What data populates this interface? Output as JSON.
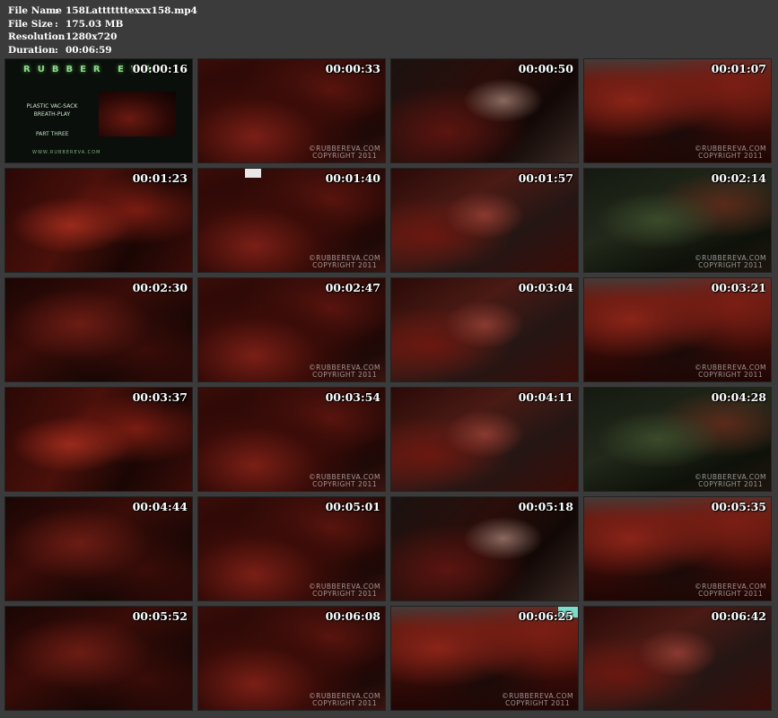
{
  "file_info": [
    {
      "key": "File Name",
      "sep": ":",
      "value": "158Latttttttexxx158.mp4"
    },
    {
      "key": "File Size",
      "sep": ":",
      "value": "175.03 MB"
    },
    {
      "key": "Resolution",
      "sep": ":",
      "value": "1280x720"
    },
    {
      "key": "Duration",
      "sep": ":",
      "value": "00:06:59"
    }
  ],
  "title_card": {
    "logo": "RUBBER EVA",
    "subtitle_line1": "PLASTIC VAC-SACK",
    "subtitle_line2": "BREATH-PLAY",
    "part": "PART THREE",
    "site": "WWW.RUBBEREVA.COM"
  },
  "watermark": {
    "line1": "©RUBBEREVA.COM",
    "line2": "COPYRIGHT 2011"
  },
  "thumbnails": [
    {
      "time": "00:00:16",
      "scene": "title"
    },
    {
      "time": "00:00:33",
      "scene": "couch-dark",
      "watermark": true
    },
    {
      "time": "00:00:50",
      "scene": "sheen"
    },
    {
      "time": "00:01:07",
      "scene": "couch-red",
      "watermark": true
    },
    {
      "time": "00:01:23",
      "scene": "red-close"
    },
    {
      "time": "00:01:40",
      "scene": "couch-dark",
      "watermark": true
    },
    {
      "time": "00:01:57",
      "scene": "red-sheen"
    },
    {
      "time": "00:02:14",
      "scene": "green-sheen",
      "watermark": true
    },
    {
      "time": "00:02:30",
      "scene": "blur-red"
    },
    {
      "time": "00:02:47",
      "scene": "couch-dark",
      "watermark": true
    },
    {
      "time": "00:03:04",
      "scene": "red-sheen"
    },
    {
      "time": "00:03:21",
      "scene": "couch-red",
      "watermark": true
    },
    {
      "time": "00:03:37",
      "scene": "red-close"
    },
    {
      "time": "00:03:54",
      "scene": "couch-dark",
      "watermark": true
    },
    {
      "time": "00:04:11",
      "scene": "red-sheen"
    },
    {
      "time": "00:04:28",
      "scene": "green-sheen",
      "watermark": true
    },
    {
      "time": "00:04:44",
      "scene": "blur-red"
    },
    {
      "time": "00:05:01",
      "scene": "couch-dark",
      "watermark": true
    },
    {
      "time": "00:05:18",
      "scene": "sheen"
    },
    {
      "time": "00:05:35",
      "scene": "couch-red",
      "watermark": true
    },
    {
      "time": "00:05:52",
      "scene": "blur-red"
    },
    {
      "time": "00:06:08",
      "scene": "couch-dark",
      "watermark": true
    },
    {
      "time": "00:06:25",
      "scene": "couch-red",
      "watermark": true
    },
    {
      "time": "00:06:42",
      "scene": "red-sheen"
    }
  ],
  "colors": {
    "background": "#3b3b3b",
    "text": "#ffffff",
    "accent_tag": "#7fdcc8"
  }
}
